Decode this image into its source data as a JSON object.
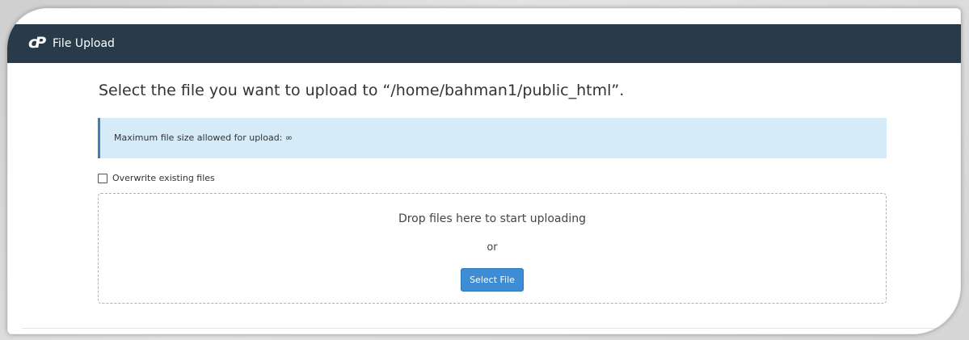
{
  "header": {
    "logo_text": "cP",
    "title": "File Upload"
  },
  "main": {
    "title": "Select the file you want to upload to “/home/bahman1/public_html”.",
    "alert_text": "Maximum file size allowed for upload: ∞",
    "overwrite_label": "Overwrite existing files",
    "overwrite_checked": false,
    "dropzone": {
      "drop_text": "Drop files here to start uploading",
      "or_text": "or",
      "select_button": "Select File"
    }
  },
  "colors": {
    "header_bg": "#293a4a",
    "alert_bg": "#d5ebf8",
    "alert_border": "#3f7fb7",
    "button_bg": "#3c8dd5"
  }
}
